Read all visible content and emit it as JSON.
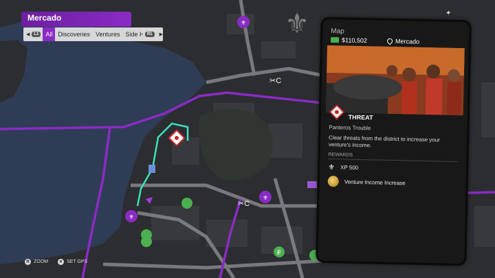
{
  "district": {
    "name": "Mercado"
  },
  "filters": {
    "left_button": "L1",
    "right_button": "R1",
    "tabs": [
      "All",
      "Discoveries",
      "Ventures",
      "Side Hustles"
    ],
    "active_tab": "All"
  },
  "hints": [
    {
      "button": "R",
      "label": "ZOOM"
    },
    {
      "button": "✕",
      "label": "SET GPS"
    }
  ],
  "phone": {
    "app_title": "Map",
    "money": "$110,502",
    "location": "Mercado",
    "category": "THREAT",
    "mission_title": "Panteros Trouble",
    "description": "Clear threats from the district to increase your venture's income.",
    "rewards_label": "REWARDS",
    "rewards": [
      {
        "icon": "fleur-de-lis-icon",
        "text": "XP 500"
      },
      {
        "icon": "gold-coin-icon",
        "text": "Venture Income Increase"
      }
    ]
  },
  "colors": {
    "accent_purple": "#8a2bc4",
    "gps_route": "#3ee0c0",
    "water": "#2e3c55",
    "land": "#2b2d30"
  },
  "map_icons": [
    "saints-fleur-icon",
    "threat-diamond-icon",
    "wrench-c-icon",
    "green-hand-icon",
    "purple-arrow-icon",
    "green-f-icon"
  ]
}
